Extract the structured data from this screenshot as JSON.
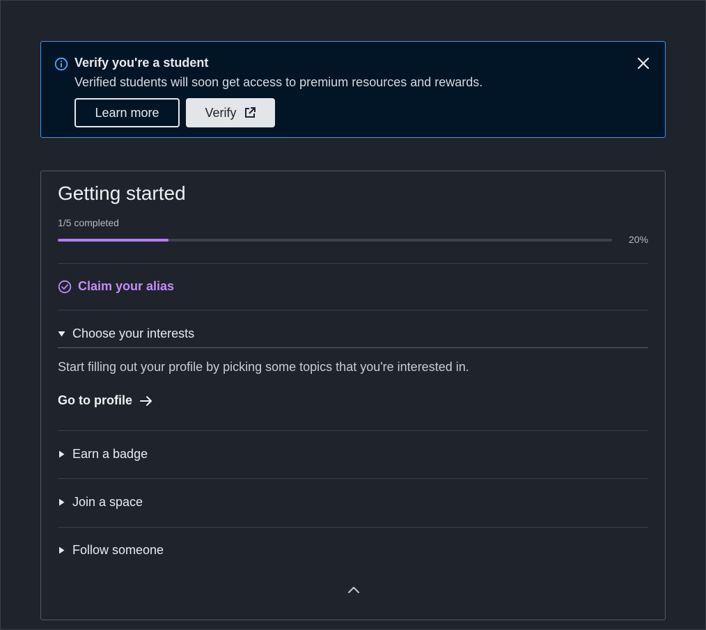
{
  "banner": {
    "title": "Verify you're a student",
    "text": "Verified students will soon get access to premium resources and rewards.",
    "learn_more_label": "Learn more",
    "verify_label": "Verify",
    "info_icon": "info-icon",
    "close_icon": "close-icon",
    "external_icon": "external-link-icon"
  },
  "card": {
    "title": "Getting started",
    "progress_label": "1/5 completed",
    "progress_percent_label": "20%",
    "progress_fraction": 0.2,
    "tasks": [
      {
        "label": "Claim your alias",
        "state": "completed",
        "icon": "check-circle-icon"
      },
      {
        "label": "Choose your interests",
        "state": "expanded",
        "icon": "caret-down-icon"
      },
      {
        "label": "Earn a badge",
        "state": "collapsed",
        "icon": "caret-right-icon"
      },
      {
        "label": "Join a space",
        "state": "collapsed",
        "icon": "caret-right-icon"
      },
      {
        "label": "Follow someone",
        "state": "collapsed",
        "icon": "caret-right-icon"
      }
    ],
    "expanded": {
      "description": "Start filling out your profile by picking some topics that you're interested in.",
      "link_label": "Go to profile",
      "link_icon": "arrow-right-icon"
    },
    "collapse_icon": "chevron-up-icon"
  },
  "colors": {
    "background": "#1f232b",
    "banner_background": "#021527",
    "banner_border": "#3f96e8",
    "accent_purple": "#c38cf7",
    "progress_fill": "#b77cf2"
  }
}
